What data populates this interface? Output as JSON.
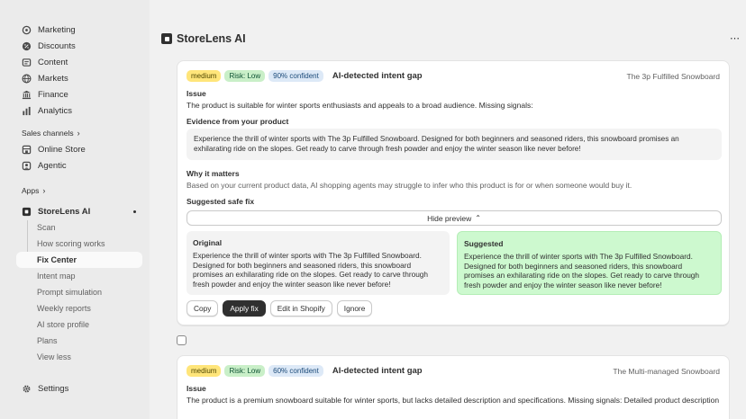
{
  "sidebar": {
    "items": [
      {
        "label": "Marketing",
        "icon": "target-icon"
      },
      {
        "label": "Discounts",
        "icon": "discount-icon"
      },
      {
        "label": "Content",
        "icon": "content-icon"
      },
      {
        "label": "Markets",
        "icon": "globe-icon"
      },
      {
        "label": "Finance",
        "icon": "bank-icon"
      },
      {
        "label": "Analytics",
        "icon": "bar-chart-icon"
      }
    ],
    "sales_channels_label": "Sales channels",
    "channels": [
      {
        "label": "Online Store",
        "icon": "store-icon"
      },
      {
        "label": "Agentic",
        "icon": "agent-icon"
      }
    ],
    "apps_label": "Apps",
    "app_name": "StoreLens AI",
    "app_subitems": [
      "Scan",
      "How scoring works",
      "Fix Center",
      "Intent map",
      "Prompt simulation",
      "Weekly reports",
      "AI store profile",
      "Plans",
      "View less"
    ],
    "settings_label": "Settings"
  },
  "page": {
    "title": "StoreLens AI"
  },
  "cards": [
    {
      "severity": "medium",
      "risk": "Risk: Low",
      "confidence": "90% confident",
      "title": "AI-detected intent gap",
      "product": "The 3p Fulfilled Snowboard",
      "issue_label": "Issue",
      "issue_text": "The product is suitable for winter sports enthusiasts and appeals to a broad audience. Missing signals:",
      "evidence_label": "Evidence from your product",
      "evidence_text": "Experience the thrill of winter sports with The 3p Fulfilled Snowboard. Designed for both beginners and seasoned riders, this snowboard promises an exhilarating ride on the slopes. Get ready to carve through fresh powder and enjoy the winter season like never before!",
      "why_label": "Why it matters",
      "why_text": "Based on your current product data, AI shopping agents may struggle to infer who this product is for or when someone would buy it.",
      "fix_label": "Suggested safe fix",
      "preview_toggle": "Hide preview",
      "original_title": "Original",
      "original_text": "Experience the thrill of winter sports with The 3p Fulfilled Snowboard. Designed for both beginners and seasoned riders, this snowboard promises an exhilarating ride on the slopes. Get ready to carve through fresh powder and enjoy the winter season like never before!",
      "suggested_title": "Suggested",
      "suggested_text": "Experience the thrill of winter sports with The 3p Fulfilled Snowboard. Designed for both beginners and seasoned riders, this snowboard promises an exhilarating ride on the slopes. Get ready to carve through fresh powder and enjoy the winter season like never before!",
      "actions": [
        "Copy",
        "Apply fix",
        "Edit in Shopify",
        "Ignore"
      ]
    },
    {
      "severity": "medium",
      "risk": "Risk: Low",
      "confidence": "60% confident",
      "title": "AI-detected intent gap",
      "product": "The Multi-managed Snowboard",
      "issue_label": "Issue",
      "issue_text": "The product is a premium snowboard suitable for winter sports, but lacks detailed description and specifications. Missing signals: Detailed product description"
    }
  ],
  "colors": {
    "badge_medium": "#ffe57a",
    "badge_risk": "#c9efc8",
    "badge_confidence": "#dde9f7",
    "suggested_bg": "#cdf9cf",
    "primary_button": "#303030"
  }
}
